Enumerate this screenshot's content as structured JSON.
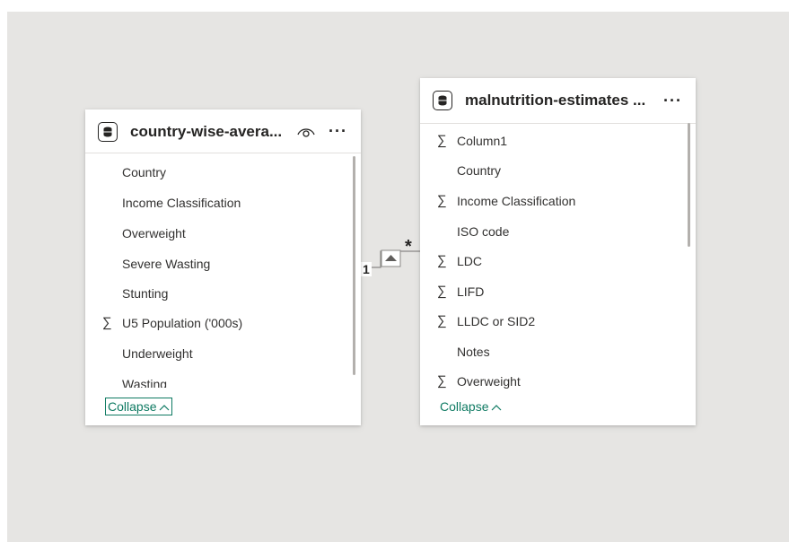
{
  "tables": [
    {
      "title": "country-wise-avera...",
      "has_eye_icon": true,
      "menu": "···",
      "fields": [
        {
          "label": "Country",
          "sigma": false
        },
        {
          "label": "Income Classification",
          "sigma": false
        },
        {
          "label": "Overweight",
          "sigma": false
        },
        {
          "label": "Severe Wasting",
          "sigma": false
        },
        {
          "label": "Stunting",
          "sigma": false
        },
        {
          "label": "U5 Population ('000s)",
          "sigma": true
        },
        {
          "label": "Underweight",
          "sigma": false
        },
        {
          "label": "Wasting",
          "sigma": false
        }
      ],
      "collapse_label": "Collapse"
    },
    {
      "title": "malnutrition-estimates ...",
      "has_eye_icon": false,
      "menu": "···",
      "fields": [
        {
          "label": "Column1",
          "sigma": true
        },
        {
          "label": "Country",
          "sigma": false
        },
        {
          "label": "Income Classification",
          "sigma": true
        },
        {
          "label": "ISO code",
          "sigma": false
        },
        {
          "label": "LDC",
          "sigma": true
        },
        {
          "label": "LIFD",
          "sigma": true
        },
        {
          "label": "LLDC or SID2",
          "sigma": true
        },
        {
          "label": "Notes",
          "sigma": false
        },
        {
          "label": "Overweight",
          "sigma": true
        }
      ],
      "collapse_label": "Collapse"
    }
  ],
  "relationship": {
    "from_cardinality": "1",
    "to_cardinality": "*",
    "direction": "single"
  },
  "icons": {
    "sigma": "∑",
    "chevron_up": "^"
  },
  "colors": {
    "canvas": "#e6e5e3",
    "collapse_text": "#0e7a62"
  }
}
